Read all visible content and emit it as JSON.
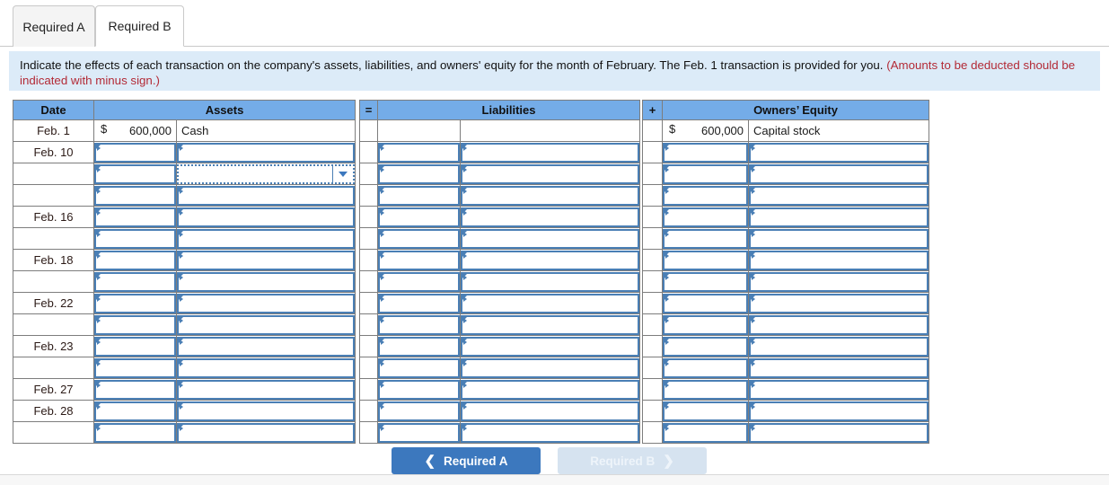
{
  "tabs": [
    {
      "label": "Required A",
      "active": false
    },
    {
      "label": "Required B",
      "active": true
    }
  ],
  "instruction": {
    "main": "Indicate the effects of each transaction on the company's assets, liabilities, and owners' equity for the month of February. The Feb. 1 transaction is provided for you.",
    "note": "(Amounts to be deducted should be indicated with minus sign.)"
  },
  "table": {
    "headers": {
      "date": "Date",
      "assets": "Assets",
      "equals": "=",
      "liabilities": "Liabilities",
      "plus": "+",
      "owners_equity": "Owners’ Equity"
    },
    "filled_row": {
      "date": "Feb. 1",
      "assets_currency": "$",
      "assets_amount": "600,000",
      "assets_description": "Cash",
      "liabilities_currency": "",
      "liabilities_amount": "",
      "liabilities_description": "",
      "oe_currency": "$",
      "oe_amount": "600,000",
      "oe_description": "Capital stock"
    },
    "input_rows": [
      {
        "date": "Feb. 10",
        "dropdown": false
      },
      {
        "date": "",
        "dropdown": true
      },
      {
        "date": "",
        "dropdown": false
      },
      {
        "date": "Feb. 16",
        "dropdown": false
      },
      {
        "date": "",
        "dropdown": false
      },
      {
        "date": "Feb. 18",
        "dropdown": false
      },
      {
        "date": "",
        "dropdown": false
      },
      {
        "date": "Feb. 22",
        "dropdown": false
      },
      {
        "date": "",
        "dropdown": false
      },
      {
        "date": "Feb. 23",
        "dropdown": false
      },
      {
        "date": "",
        "dropdown": false
      },
      {
        "date": "Feb. 27",
        "dropdown": false
      },
      {
        "date": "Feb. 28",
        "dropdown": false
      },
      {
        "date": "",
        "dropdown": false
      }
    ]
  },
  "nav": {
    "prev_label": "Required A",
    "prev_icon": "chevron-left",
    "next_label": "Required B",
    "next_icon": "chevron-right"
  },
  "colors": {
    "header_blue": "#74ace8",
    "banner_blue": "#dcebf8",
    "note_red": "#b32a36",
    "input_border": "#4a7fb5",
    "primary_button": "#3c78be",
    "disabled_button": "#d6e3f0"
  }
}
